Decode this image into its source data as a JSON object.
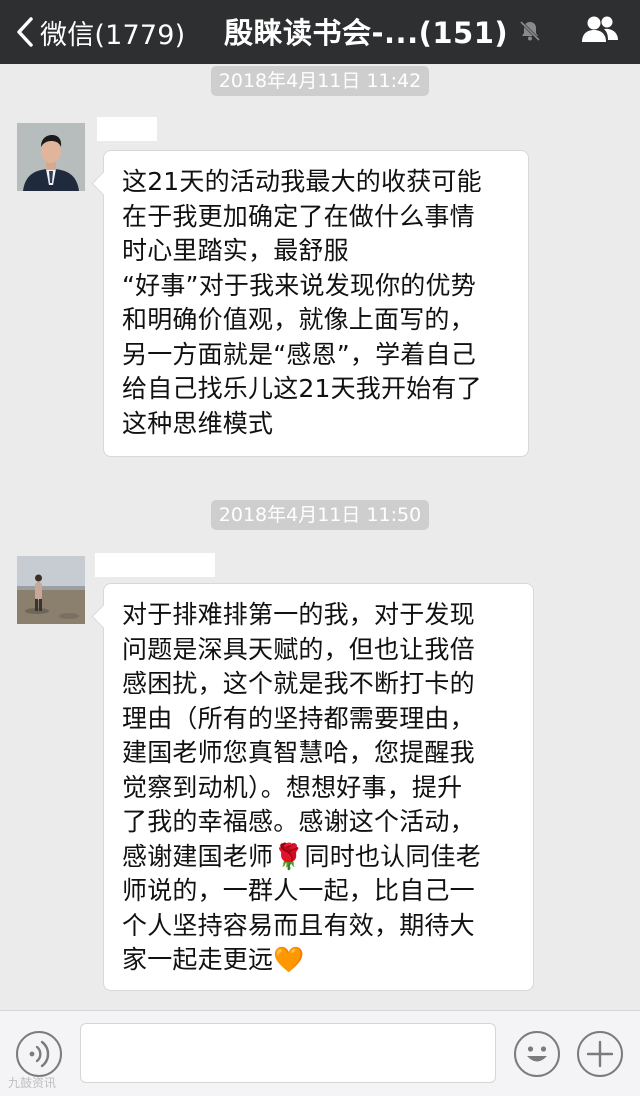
{
  "header": {
    "back_label": "微信(1779)",
    "title": "殷睐读书会-...(151)"
  },
  "timestamps": [
    "2018年4月11日 11:42",
    "2018年4月11日 11:50"
  ],
  "messages": [
    {
      "lines": [
        "这21天的活动我最大的收获可能",
        "在于我更加确定了在做什么事情",
        "时心里踏实，最舒服",
        "“好事”对于我来说发现你的优势",
        "和明确价值观，就像上面写的，",
        "另一方面就是“感恩”，学着自己",
        "给自己找乐儿这21天我开始有了",
        "这种思维模式"
      ]
    },
    {
      "lines": [
        "对于排难排第一的我，对于发现",
        "问题是深具天赋的，但也让我倍",
        "感困扰，这个就是我不断打卡的",
        "理由（所有的坚持都需要理由，",
        "建国老师您真智慧哈，您提醒我",
        "觉察到动机）。想想好事，提升",
        "了我的幸福感。感谢这个活动，",
        "感谢建国老师🌹同时也认同佳老",
        "师说的，一群人一起，比自己一",
        "个人坚持容易而且有效，期待大",
        "家一起走更远🧡"
      ]
    }
  ],
  "watermark": "九鼓资讯",
  "icons": {
    "back": "chevron-left-icon",
    "mute": "mute-bell-icon",
    "people": "group-members-icon",
    "voice": "voice-icon",
    "emoji": "emoji-icon",
    "plus": "plus-icon"
  }
}
